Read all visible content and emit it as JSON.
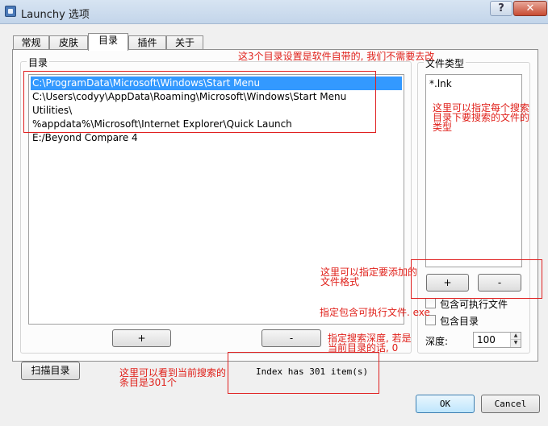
{
  "window": {
    "title": "Launchy 选项",
    "help_label": "?",
    "close_label": "✕"
  },
  "tabs": [
    {
      "label": "常规",
      "active": false
    },
    {
      "label": "皮肤",
      "active": false
    },
    {
      "label": "目录",
      "active": true
    },
    {
      "label": "插件",
      "active": false
    },
    {
      "label": "关于",
      "active": false
    }
  ],
  "directories": {
    "group_label": "目录",
    "items": [
      "C:\\ProgramData\\Microsoft\\Windows\\Start Menu",
      "C:\\Users\\codyy\\AppData\\Roaming\\Microsoft\\Windows\\Start Menu",
      "Utilities\\",
      "%appdata%\\Microsoft\\Internet Explorer\\Quick Launch",
      "E:/Beyond Compare 4"
    ],
    "selected_index": 0,
    "add_label": "+",
    "remove_label": "-"
  },
  "file_types": {
    "group_label": "文件类型",
    "items": [
      "*.lnk"
    ],
    "add_label": "+",
    "remove_label": "-",
    "include_executables_label": "包含可执行文件",
    "include_executables_checked": false,
    "include_directories_label": "包含目录",
    "include_directories_checked": false,
    "depth_label": "深度:",
    "depth_value": "100",
    "spin_up": "▲",
    "spin_down": "▼"
  },
  "bottom": {
    "rescan_label": "扫描目录",
    "status_text": "Index has 301 item(s)",
    "ok_label": "OK",
    "cancel_label": "Cancel"
  },
  "annotations": {
    "dirs_note": "这3个目录设置是软件自带的, 我们不需要去改",
    "filetype_note_1": "这里可以指定每个搜索",
    "filetype_note_2": "目录下要搜索的文件的",
    "filetype_note_3": "类型",
    "add_format_note_1": "这里可以指定要添加的",
    "add_format_note_2": "文件格式",
    "exe_note": "指定包含可执行文件. exe",
    "depth_note_1": "指定搜索深度, 若是",
    "depth_note_2": "当前目录的话, 0",
    "count_note_1": "这里可以看到当前搜索的",
    "count_note_2": "条目是301个"
  },
  "colors": {
    "selection": "#3399ff",
    "annotation_red": "#e0201a"
  }
}
